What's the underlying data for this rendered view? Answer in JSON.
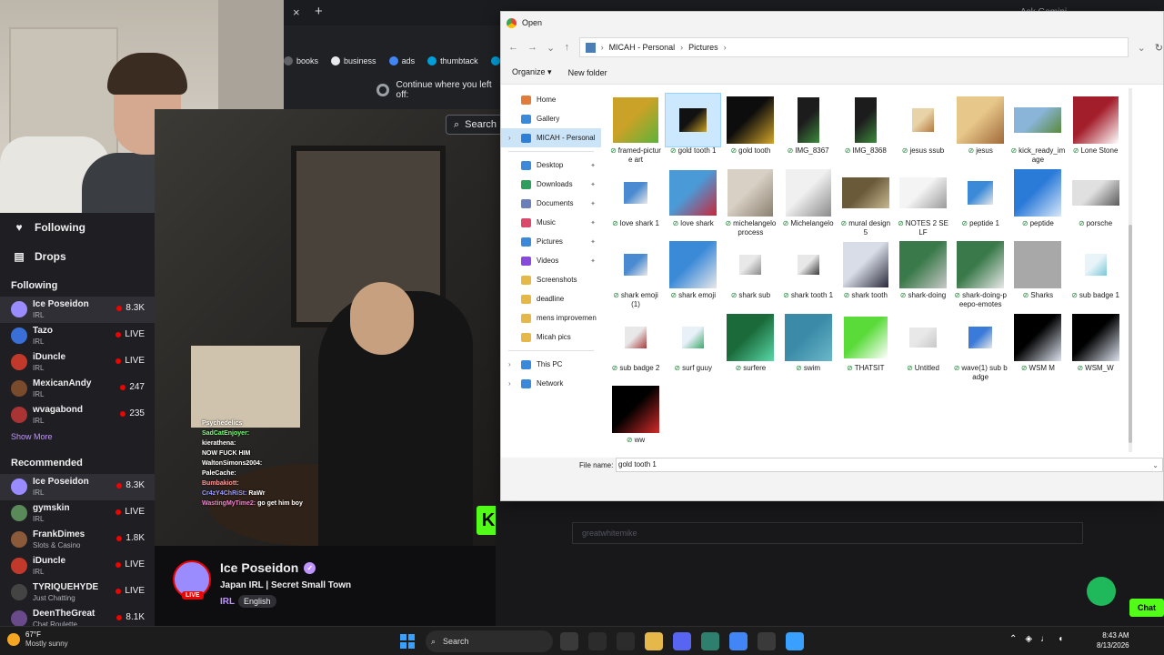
{
  "browser": {
    "tab_close": "×",
    "tab_new": "+",
    "ask_gemini": "Ask Gemini",
    "bookmarks": [
      {
        "label": "books",
        "color": "#5f6368"
      },
      {
        "label": "business",
        "color": "#e8eaed"
      },
      {
        "label": "ads",
        "color": "#4285f4"
      },
      {
        "label": "thumbtack",
        "color": "#009fd9"
      },
      {
        "label": "Thumbta",
        "color": "#009fd9"
      }
    ],
    "restore_text": "Continue where you left off:",
    "search_label": "Search"
  },
  "twitch": {
    "nav": [
      {
        "label": "Following",
        "icon": "heart-icon"
      },
      {
        "label": "Drops",
        "icon": "drops-icon"
      }
    ],
    "following_title": "Following",
    "following": [
      {
        "name": "Ice Poseidon",
        "sub": "IRL",
        "stat": "8.3K",
        "color": "#9a8cff",
        "active": true
      },
      {
        "name": "Tazo",
        "sub": "IRL",
        "stat": "LIVE",
        "color": "#3a6fd8"
      },
      {
        "name": "iDuncle",
        "sub": "IRL",
        "stat": "LIVE",
        "color": "#c0392b"
      },
      {
        "name": "MexicanAndy",
        "sub": "IRL",
        "stat": "247",
        "color": "#7a4a2c"
      },
      {
        "name": "wvagabond",
        "sub": "IRL",
        "stat": "235",
        "color": "#a33"
      }
    ],
    "show_more": "Show More",
    "recommended_title": "Recommended",
    "recommended": [
      {
        "name": "Ice Poseidon",
        "sub": "IRL",
        "stat": "8.3K",
        "color": "#9a8cff",
        "active": true
      },
      {
        "name": "gymskin",
        "sub": "IRL",
        "stat": "LIVE",
        "color": "#5a8a5a"
      },
      {
        "name": "FrankDimes",
        "sub": "Slots & Casino",
        "stat": "1.8K",
        "color": "#8a5a3a"
      },
      {
        "name": "iDuncle",
        "sub": "IRL",
        "stat": "LIVE",
        "color": "#c0392b"
      },
      {
        "name": "TYRIQUEHYDE",
        "sub": "Just Chatting",
        "stat": "LIVE",
        "color": "#444"
      },
      {
        "name": "DeenTheGreat",
        "sub": "Chat Roulette",
        "stat": "8.1K",
        "color": "#6a4a8a"
      }
    ],
    "stream": {
      "name": "Ice Poseidon",
      "live": "LIVE",
      "title": "Japan IRL | Secret Small Town",
      "category": "IRL",
      "tag": "English"
    },
    "chat": [
      {
        "user": "",
        "text": "Psychedelics",
        "color": "#ff7bd8"
      },
      {
        "user": "SadCatEnjoyer:",
        "text": "",
        "color": "#7bff7b"
      },
      {
        "user": "kierathena:",
        "text": "",
        "color": "#ffffff"
      },
      {
        "user": "",
        "text": "NOW FUCK HIM",
        "color": "#ffffff"
      },
      {
        "user": "WaltonSimons2004:",
        "text": "",
        "color": "#ffffff"
      },
      {
        "user": "PaleCache:",
        "text": "",
        "color": "#ffffff"
      },
      {
        "user": "Bumbakiott:",
        "text": "",
        "color": "#ff9b9b"
      },
      {
        "user": "Cr4zY4ChRiSt:",
        "text": "RaWr",
        "color": "#9b9bff"
      },
      {
        "user": "WastingMyTime2:",
        "text": "go get him boy",
        "color": "#ff7bd8"
      }
    ],
    "bg_chat_placeholder": "greatwhitemike",
    "bg_chat_button": "Chat"
  },
  "dialog": {
    "title": "Open",
    "breadcrumb": [
      "MICAH - Personal",
      "Pictures"
    ],
    "toolbar": {
      "organize": "Organize",
      "new_folder": "New folder"
    },
    "nav_pane": [
      {
        "label": "Home",
        "color": "#e07b39",
        "group": 1
      },
      {
        "label": "Gallery",
        "color": "#3b8ad9",
        "group": 1
      },
      {
        "label": "MICAH - Personal",
        "color": "#2f7fd6",
        "group": 1,
        "selected": true,
        "expander": true
      },
      {
        "label": "Desktop",
        "color": "#3b8ad9",
        "group": 2,
        "pinned": true
      },
      {
        "label": "Downloads",
        "color": "#2f9e5c",
        "group": 2,
        "pinned": true
      },
      {
        "label": "Documents",
        "color": "#6a7fb8",
        "group": 2,
        "pinned": true
      },
      {
        "label": "Music",
        "color": "#d94a6a",
        "group": 2,
        "pinned": true
      },
      {
        "label": "Pictures",
        "color": "#3b8ad9",
        "group": 2,
        "pinned": true
      },
      {
        "label": "Videos",
        "color": "#8a4ad9",
        "group": 2,
        "pinned": true
      },
      {
        "label": "Screenshots",
        "color": "#e6b84a",
        "group": 2
      },
      {
        "label": "deadline",
        "color": "#e6b84a",
        "group": 2
      },
      {
        "label": "mens improvemen",
        "color": "#e6b84a",
        "group": 2
      },
      {
        "label": "Micah pics",
        "color": "#e6b84a",
        "group": 2
      },
      {
        "label": "This PC",
        "color": "#3b8ad9",
        "group": 3,
        "expander": true
      },
      {
        "label": "Network",
        "color": "#3b8ad9",
        "group": 3,
        "expander": true
      }
    ],
    "top_cut_label": "badge",
    "files": [
      {
        "label": "framed-picture art",
        "c1": "#c9a227",
        "c2": "#5db33a",
        "w": 50,
        "h": 50
      },
      {
        "label": "gold tooth 1",
        "c1": "#111111",
        "c2": "#c9a227",
        "w": 30,
        "h": 26,
        "selected": true
      },
      {
        "label": "gold tooth",
        "c1": "#0d0d0d",
        "c2": "#d4a52a",
        "w": 52,
        "h": 52
      },
      {
        "label": "IMG_8367",
        "c1": "#1c1c1c",
        "c2": "#3c8a3c",
        "w": 24,
        "h": 50
      },
      {
        "label": "IMG_8368",
        "c1": "#1c1c1c",
        "c2": "#3c8a3c",
        "w": 24,
        "h": 50
      },
      {
        "label": "jesus ssub",
        "c1": "#e8d3a8",
        "c2": "#b5793d",
        "w": 24,
        "h": 26
      },
      {
        "label": "jesus",
        "c1": "#e8c78a",
        "c2": "#a06a3a",
        "w": 52,
        "h": 52
      },
      {
        "label": "kick_ready_image",
        "c1": "#8ab4d8",
        "c2": "#5a8a3a",
        "w": 52,
        "h": 28
      },
      {
        "label": "Lone Stone",
        "c1": "#a31e2b",
        "c2": "#ffffff",
        "w": 50,
        "h": 52
      },
      {
        "label": "love shark 1",
        "c1": "#4a8ad0",
        "c2": "#e8e8e8",
        "w": 26,
        "h": 24
      },
      {
        "label": "love shark",
        "c1": "#4a9ad8",
        "c2": "#c8283a",
        "w": 52,
        "h": 50
      },
      {
        "label": "michelangelo process",
        "c1": "#d8d0c4",
        "c2": "#8a8070",
        "w": 50,
        "h": 52
      },
      {
        "label": "Michelangelo",
        "c1": "#f0f0f0",
        "c2": "#8a8a8a",
        "w": 50,
        "h": 52
      },
      {
        "label": "mural design 5",
        "c1": "#6a5a3a",
        "c2": "#c8b890",
        "w": 52,
        "h": 34
      },
      {
        "label": "NOTES 2 SELF",
        "c1": "#f4f4f4",
        "c2": "#9a9a9a",
        "w": 52,
        "h": 34
      },
      {
        "label": "peptide 1",
        "c1": "#3a8ad8",
        "c2": "#e8e8e8",
        "w": 28,
        "h": 26
      },
      {
        "label": "peptide",
        "c1": "#2a7ad8",
        "c2": "#d8e8f8",
        "w": 52,
        "h": 52
      },
      {
        "label": "porsche",
        "c1": "#e0e0e0",
        "c2": "#5a5a5a",
        "w": 52,
        "h": 28
      },
      {
        "label": "shark emoji (1)",
        "c1": "#4a8ad0",
        "c2": "#e8e8e8",
        "w": 26,
        "h": 24
      },
      {
        "label": "shark emoji",
        "c1": "#3a8ad8",
        "c2": "#e8e8e8",
        "w": 52,
        "h": 52
      },
      {
        "label": "shark sub",
        "c1": "#e8e8e8",
        "c2": "#8a8a8a",
        "w": 24,
        "h": 22
      },
      {
        "label": "shark tooth 1",
        "c1": "#e8e8e8",
        "c2": "#3a3a3a",
        "w": 24,
        "h": 22
      },
      {
        "label": "shark tooth",
        "c1": "#d8dde8",
        "c2": "#2a2a3a",
        "w": 50,
        "h": 50
      },
      {
        "label": "shark-doing",
        "c1": "#3a7a4a",
        "c2": "#c8c8c8",
        "w": 52,
        "h": 52
      },
      {
        "label": "shark-doing-peepo-emotes",
        "c1": "#3a7a4a",
        "c2": "#e8e8e8",
        "w": 52,
        "h": 52
      },
      {
        "label": "Sharks",
        "c1": "#a8a8a8",
        "c2": "#a8a8a8",
        "w": 52,
        "h": 52
      },
      {
        "label": "sub badge 1",
        "c1": "#e8f4f8",
        "c2": "#7ac8d8",
        "w": 24,
        "h": 24
      },
      {
        "label": "sub badge 2",
        "c1": "#e8e8e8",
        "c2": "#a83a3a",
        "w": 24,
        "h": 24
      },
      {
        "label": "surf guuy",
        "c1": "#e8f0f8",
        "c2": "#3aa86a",
        "w": 24,
        "h": 24
      },
      {
        "label": "surfere",
        "c1": "#1a6a3a",
        "c2": "#5ad8a8",
        "w": 52,
        "h": 52
      },
      {
        "label": "swim",
        "c1": "#3a8aa8",
        "c2": "#6ab8c8",
        "w": 52,
        "h": 52
      },
      {
        "label": "THATSIT",
        "c1": "#5adb3a",
        "c2": "#ffffff",
        "w": 48,
        "h": 46
      },
      {
        "label": "Untitled",
        "c1": "#e8e8e8",
        "c2": "#c8c8c8",
        "w": 30,
        "h": 22
      },
      {
        "label": "wave(1) sub badge",
        "c1": "#3a7ad8",
        "c2": "#e8e8e8",
        "w": 26,
        "h": 24
      },
      {
        "label": "WSM M",
        "c1": "#000000",
        "c2": "#dde3f0",
        "w": 52,
        "h": 52
      },
      {
        "label": "WSM_W",
        "c1": "#000000",
        "c2": "#dde3f0",
        "w": 52,
        "h": 52
      },
      {
        "label": "ww",
        "c1": "#000000",
        "c2": "#d42a2a",
        "w": 52,
        "h": 52
      }
    ],
    "filename_label": "File name:",
    "filename_value": "gold tooth 1"
  },
  "taskbar": {
    "weather_temp": "67°F",
    "weather_cond": "Mostly sunny",
    "search_label": "Search",
    "apps": [
      {
        "icon": "widgets-icon",
        "color": "#3a3a3a"
      },
      {
        "icon": "task-view-icon",
        "color": "#2c2c2c"
      },
      {
        "icon": "notepad-icon",
        "color": "#2c2c2c"
      },
      {
        "icon": "file-explorer-icon",
        "color": "#e6b84a"
      },
      {
        "icon": "discord-icon",
        "color": "#5865f2"
      },
      {
        "icon": "app-icon",
        "color": "#2f7f6f"
      },
      {
        "icon": "chrome-icon",
        "color": "#4285f4"
      },
      {
        "icon": "obs-icon",
        "color": "#3a3a3a"
      },
      {
        "icon": "notes-icon",
        "color": "#3aa0ff"
      }
    ],
    "time": "8:43 AM",
    "date": "8/13/2026"
  }
}
